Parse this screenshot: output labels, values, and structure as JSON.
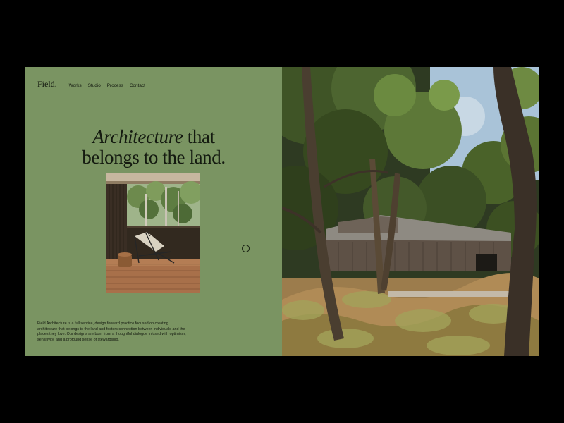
{
  "nav": {
    "logo": "Field.",
    "links": [
      "Works",
      "Studio",
      "Process",
      "Contact"
    ]
  },
  "hero": {
    "headline_em": "Architecture",
    "headline_rest": " that",
    "headline_line2": "belongs to the land.",
    "description": "Field Architecture is a full service, design forward practice focused on creating architecture that belongs to the land and fosters connection between individuals and the places they love. Our designs are born from a thoughtful dialogue infused with optimism, sensitivity, and a profound sense of stewardship."
  },
  "colors": {
    "background": "#000000",
    "panel": "#7a9462",
    "text": "#141a10"
  },
  "icons": [
    "slider-dot-icon"
  ]
}
